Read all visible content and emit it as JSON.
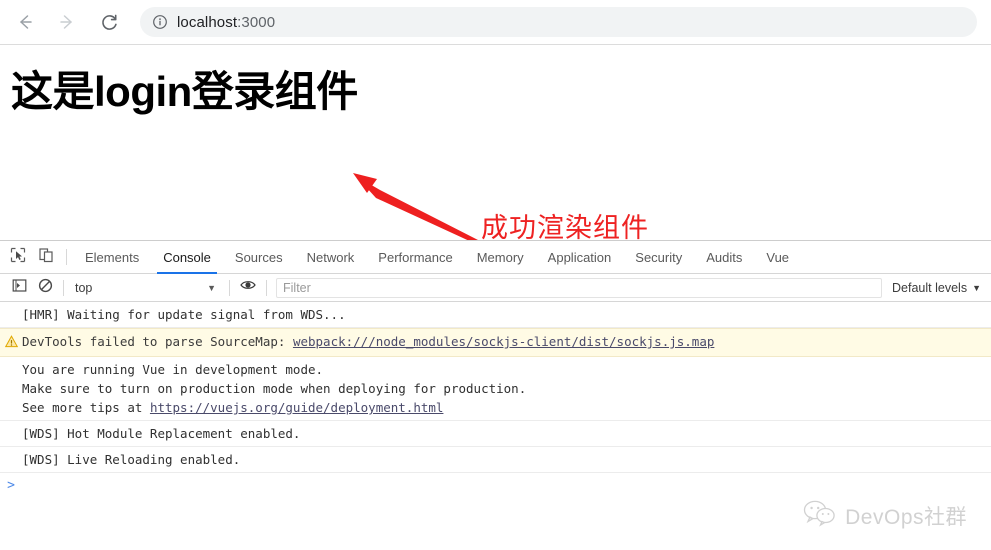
{
  "browser": {
    "back_icon": "arrow-left-icon",
    "forward_icon": "arrow-right-icon",
    "reload_icon": "reload-icon",
    "site_info_icon": "info-circle-icon",
    "url_host": "localhost",
    "url_port": ":3000",
    "url_full": "localhost:3000"
  },
  "page": {
    "heading": "这是login登录组件",
    "annotation": "成功渲染组件",
    "annotation_color": "#ee2222",
    "arrow_icon": "red-arrow-icon"
  },
  "devtools": {
    "inspect_icon": "inspect-element-icon",
    "device_icon": "device-toolbar-icon",
    "tabs": [
      {
        "label": "Elements",
        "active": false
      },
      {
        "label": "Console",
        "active": true
      },
      {
        "label": "Sources",
        "active": false
      },
      {
        "label": "Network",
        "active": false
      },
      {
        "label": "Performance",
        "active": false
      },
      {
        "label": "Memory",
        "active": false
      },
      {
        "label": "Application",
        "active": false
      },
      {
        "label": "Security",
        "active": false
      },
      {
        "label": "Audits",
        "active": false
      },
      {
        "label": "Vue",
        "active": false
      }
    ],
    "active_tab_underline_color": "#1a73e8",
    "toolbar": {
      "sidebar_toggle_icon": "console-sidebar-icon",
      "clear_console_icon": "clear-console-icon",
      "context_value": "top",
      "context_caret": "▼",
      "eye_icon": "eye-icon",
      "filter_placeholder": "Filter",
      "filter_value": "",
      "levels_label": "Default levels",
      "levels_caret": "▼"
    },
    "console_rows": [
      {
        "level": "log",
        "icon": "",
        "text": "[HMR] Waiting for update signal from WDS..."
      },
      {
        "level": "warning",
        "icon": "warning-triangle-icon",
        "text_before": "DevTools failed to parse SourceMap: ",
        "link": "webpack:///node_modules/sockjs-client/dist/sockjs.js.map"
      },
      {
        "level": "log",
        "icon": "",
        "line1": "You are running Vue in development mode.",
        "line2": "Make sure to turn on production mode when deploying for production.",
        "line3_before": "See more tips at ",
        "link": "https://vuejs.org/guide/deployment.html"
      },
      {
        "level": "log",
        "icon": "",
        "text": "[WDS] Hot Module Replacement enabled."
      },
      {
        "level": "log",
        "icon": "",
        "text": "[WDS] Live Reloading enabled."
      }
    ],
    "prompt_caret": ">"
  },
  "watermark": {
    "icon": "wechat-icon",
    "text": "DevOps社群"
  }
}
